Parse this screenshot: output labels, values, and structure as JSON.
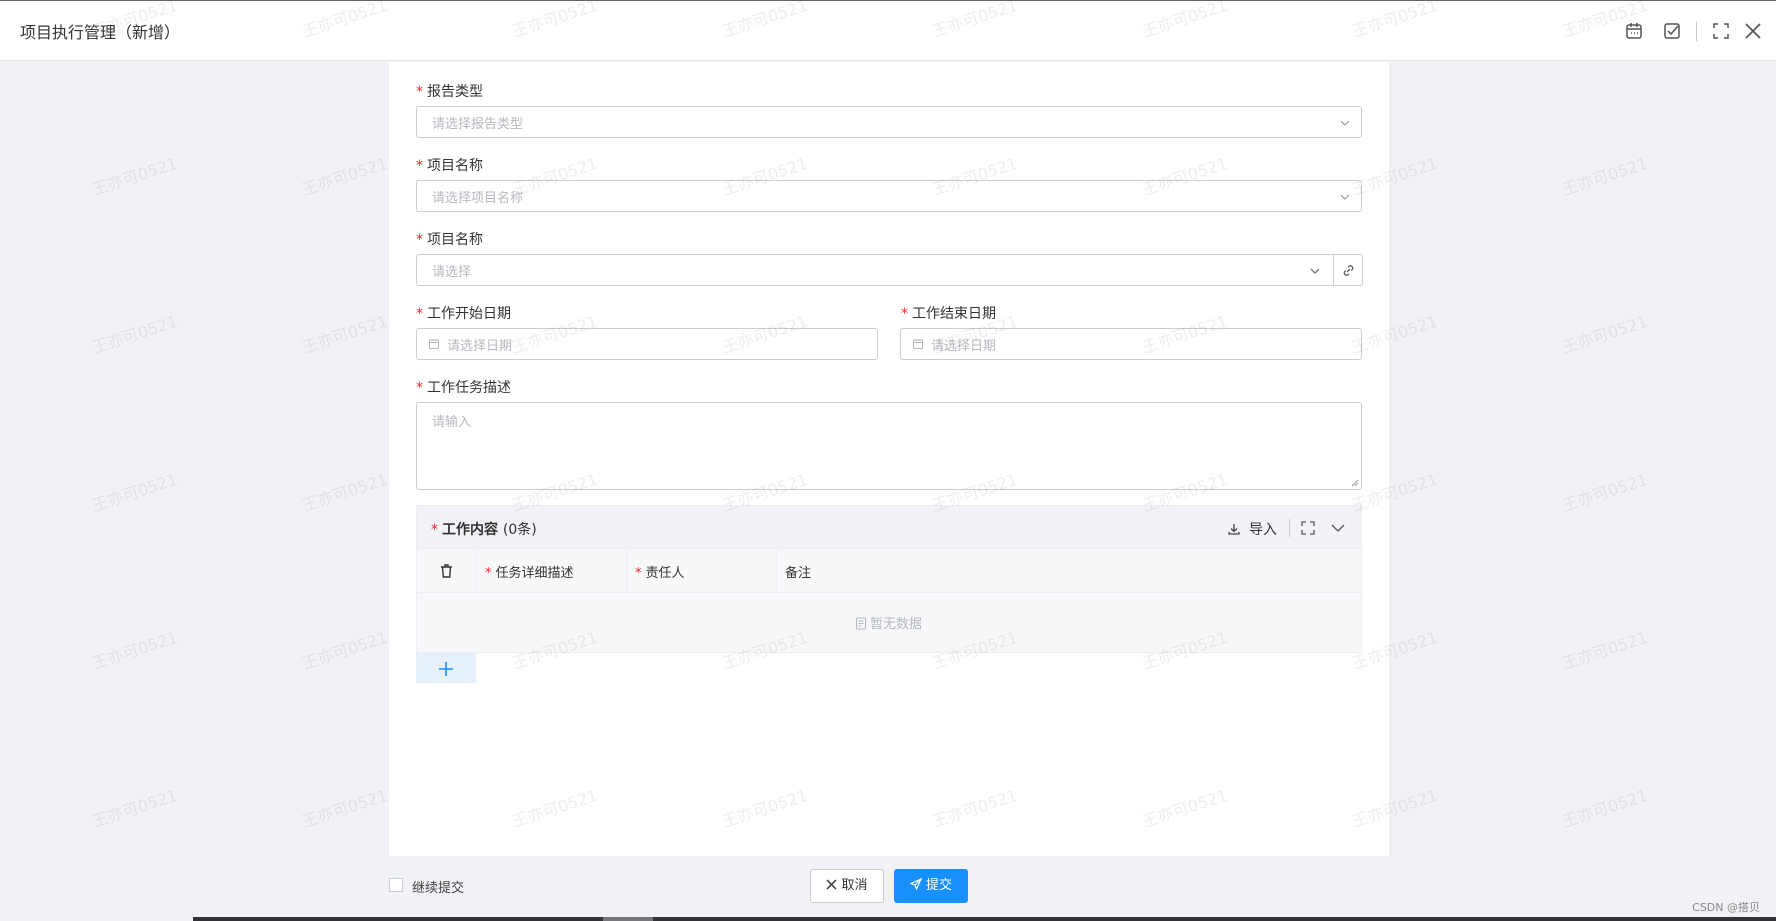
{
  "header": {
    "title": "项目执行管理（新增）"
  },
  "form": {
    "report_type": {
      "label": "报告类型",
      "placeholder": "请选择报告类型"
    },
    "project_name": {
      "label": "项目名称",
      "placeholder": "请选择项目名称"
    },
    "project_name2": {
      "label": "项目名称",
      "placeholder": "请选择"
    },
    "start_date": {
      "label": "工作开始日期",
      "placeholder": "请选择日期"
    },
    "end_date": {
      "label": "工作结束日期",
      "placeholder": "请选择日期"
    },
    "task_desc": {
      "label": "工作任务描述",
      "placeholder": "请输入"
    }
  },
  "subtable": {
    "title": "工作内容",
    "count": "(0条)",
    "import_label": "导入",
    "columns": [
      "任务详细描述",
      "责任人",
      "备注"
    ],
    "empty_text": "暂无数据"
  },
  "footer": {
    "continue_label": "继续提交",
    "cancel_label": "取消",
    "submit_label": "提交",
    "credit": "CSDN @搭贝"
  },
  "watermark": "王亦可0521",
  "colors": {
    "primary": "#1890ff",
    "required": "#f5222d"
  }
}
